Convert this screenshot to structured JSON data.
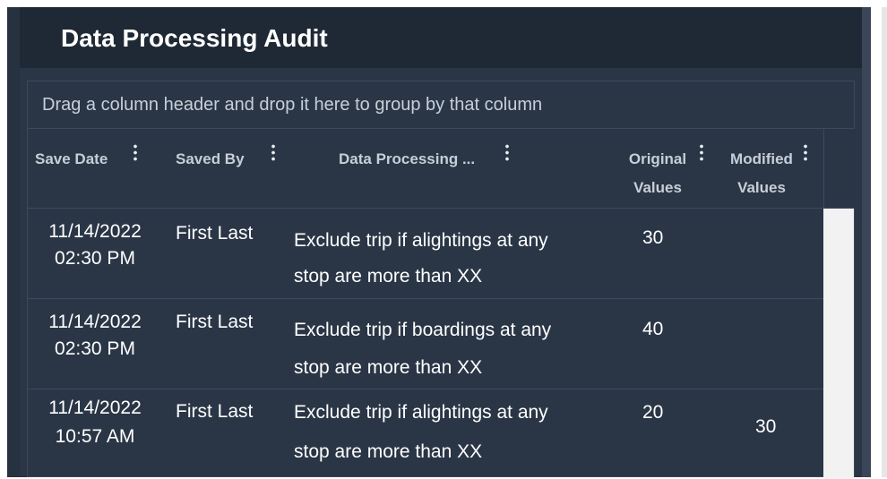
{
  "window": {
    "title": "Data Processing Audit"
  },
  "grid": {
    "group_hint": "Drag a column header and drop it here to group by that column",
    "columns": [
      {
        "label": "Save Date"
      },
      {
        "label": "Saved By"
      },
      {
        "label": "Data Processing ..."
      },
      {
        "label_line1": "Original",
        "label_line2": "Values"
      },
      {
        "label_line1": "Modified",
        "label_line2": "Values"
      }
    ],
    "rows": [
      {
        "save_date": "11/14/2022",
        "save_time": "02:30 PM",
        "saved_by": "First Last",
        "rule_prefix": "Exclude trip if",
        "rule_field": "alightings at any",
        "rule_mid": "stop are more than",
        "rule_param": "XX",
        "original": "30",
        "modified": ""
      },
      {
        "save_date": "11/14/2022",
        "save_time": "02:30 PM",
        "saved_by": "First Last",
        "rule_prefix": "Exclude trip if",
        "rule_field": "boardings at any",
        "rule_mid": "stop are more than",
        "rule_param": "XX",
        "original": "40",
        "modified": ""
      },
      {
        "save_date": "11/14/2022",
        "save_time": "10:57 AM",
        "saved_by": "First Last",
        "rule_prefix": "Exclude trip if",
        "rule_field": "alightings at any",
        "rule_mid": "stop are more than",
        "rule_param": "XX",
        "original": "20",
        "modified": "30"
      }
    ]
  }
}
